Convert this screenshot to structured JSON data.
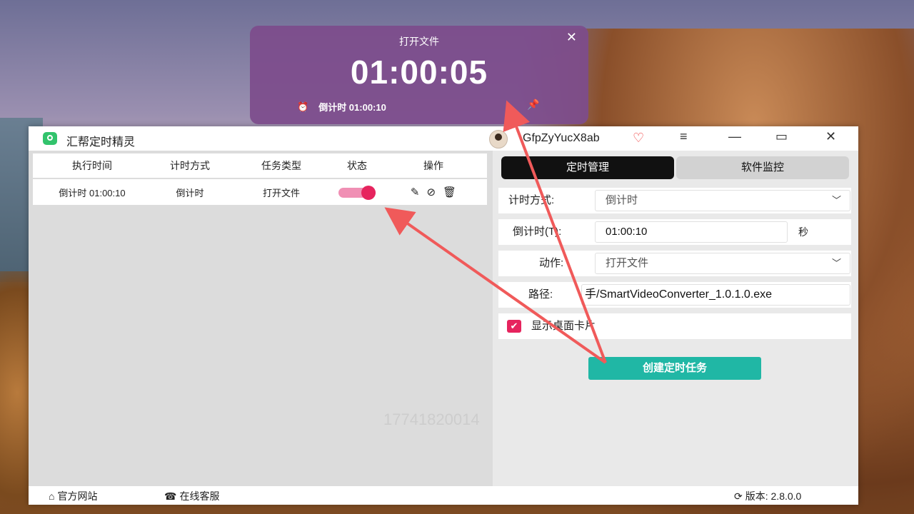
{
  "card": {
    "title": "打开文件",
    "time": "01:00:05",
    "subtitle": "倒计时 01:00:10",
    "close_icon": "close-icon",
    "pin_icon": "pin-icon"
  },
  "window": {
    "app_name": "汇帮定时精灵",
    "username": "GfpZyYucX8ab",
    "controls": [
      "menu-icon",
      "minimize-icon",
      "maximize-icon",
      "close-icon"
    ]
  },
  "table": {
    "headers": [
      "执行时间",
      "计时方式",
      "任务类型",
      "状态",
      "操作"
    ],
    "rows": [
      {
        "time": "倒计时 01:00:10",
        "mode": "倒计时",
        "type": "打开文件",
        "enabled": true
      }
    ]
  },
  "watermark": "17741820014",
  "tabs": [
    "定时管理",
    "软件监控"
  ],
  "form": {
    "mode_label": "计时方式:",
    "mode_value": "倒计时",
    "countdown_label": "倒计时(T):",
    "countdown_value": "01:00:10",
    "countdown_unit": "秒",
    "action_label": "动作:",
    "action_value": "打开文件",
    "path_label": "路径:",
    "path_value": "手/SmartVideoConverter_1.0.1.0.exe",
    "show_card_label": "显示桌面卡片",
    "show_card_checked": true,
    "create_button": "创建定时任务"
  },
  "footer": {
    "website": "官方网站",
    "support": "在线客服",
    "version": "版本: 2.8.0.0"
  },
  "colors": {
    "accent": "#20b7a5",
    "toggle": "#e6245e",
    "card_bg": "#7d4c8c",
    "arrow": "#f05a5a"
  }
}
